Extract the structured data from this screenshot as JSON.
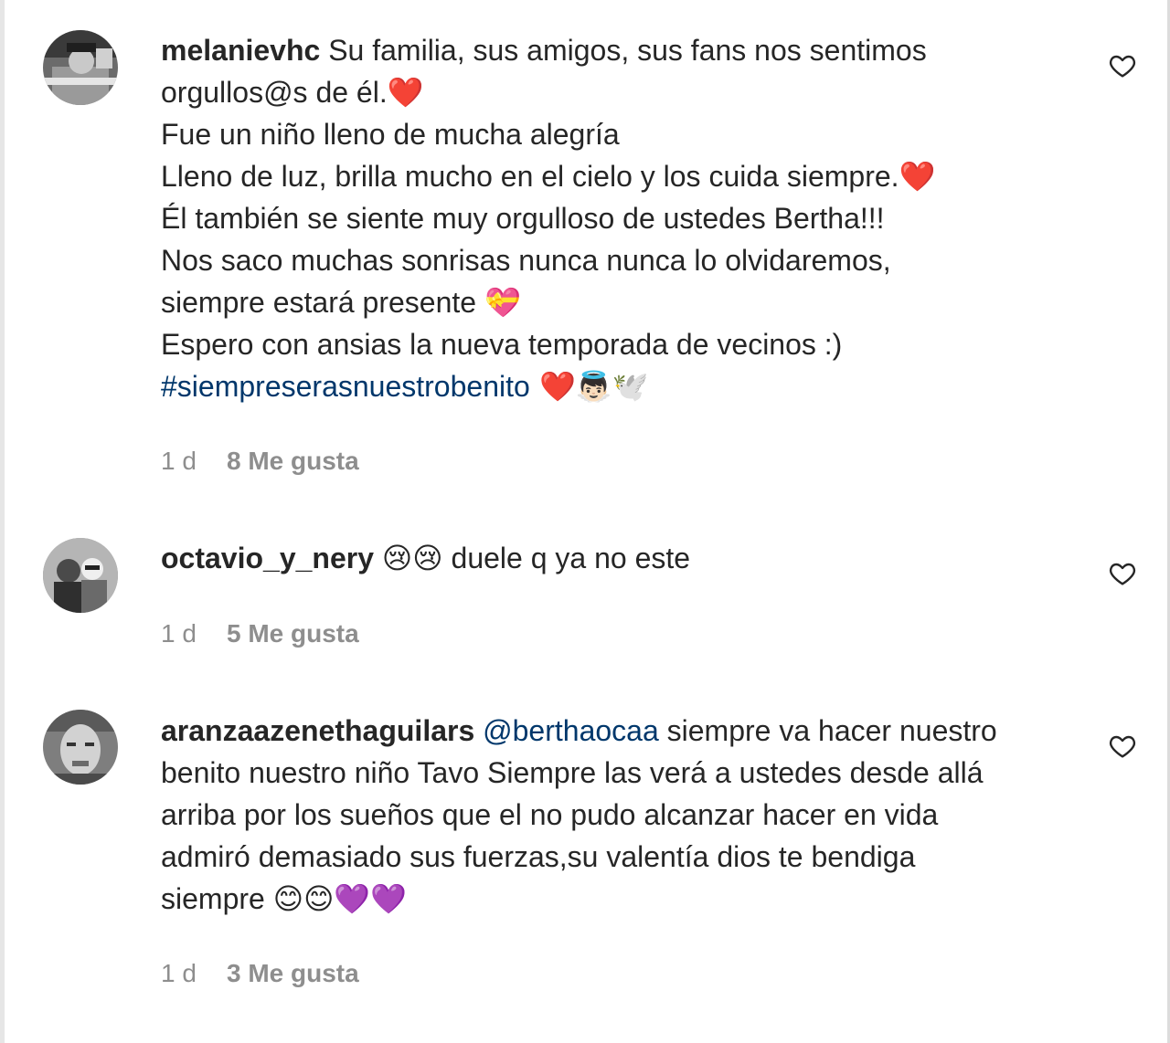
{
  "comments": [
    {
      "username": "melanievhc",
      "lines": [
        "Su familia, sus amigos, sus fans nos sentimos",
        "orgullos@s de él.❤️",
        "Fue un niño lleno de mucha alegría",
        "Lleno de luz, brilla mucho en el cielo y los cuida siempre.❤️",
        "Él también se siente muy orgulloso de ustedes Bertha!!!",
        "Nos saco muchas sonrisas nunca nunca lo olvidaremos,",
        "siempre estará presente 💝",
        "Espero con ansias la nueva temporada de vecinos :)"
      ],
      "hashtag": "#siempreserasnuestrobenito",
      "hashtag_suffix": " ❤️👼🏻🕊️",
      "time": "1 d",
      "likes": "8 Me gusta",
      "like_icon": "heart-outline-icon"
    },
    {
      "username": "octavio_y_nery",
      "text": " 😢😢 duele q ya no este",
      "time": "1 d",
      "likes": "5 Me gusta",
      "like_icon": "heart-outline-icon"
    },
    {
      "username": "aranzaazenethaguilars",
      "mention": "@berthaocaa",
      "text_first": " siempre va hacer nuestro",
      "lines": [
        "benito nuestro niño Tavo Siempre las verá a ustedes desde allá",
        "arriba por los sueños que el no pudo alcanzar hacer en vida",
        "admiró demasiado sus fuerzas,su valentía dios te bendiga",
        "siempre 😊😊💜💜"
      ],
      "time": "1 d",
      "likes": "3 Me gusta",
      "like_icon": "heart-outline-icon"
    }
  ],
  "colors": {
    "text": "#262626",
    "link": "#00376b",
    "meta": "#8e8e8e",
    "background": "#ffffff"
  }
}
